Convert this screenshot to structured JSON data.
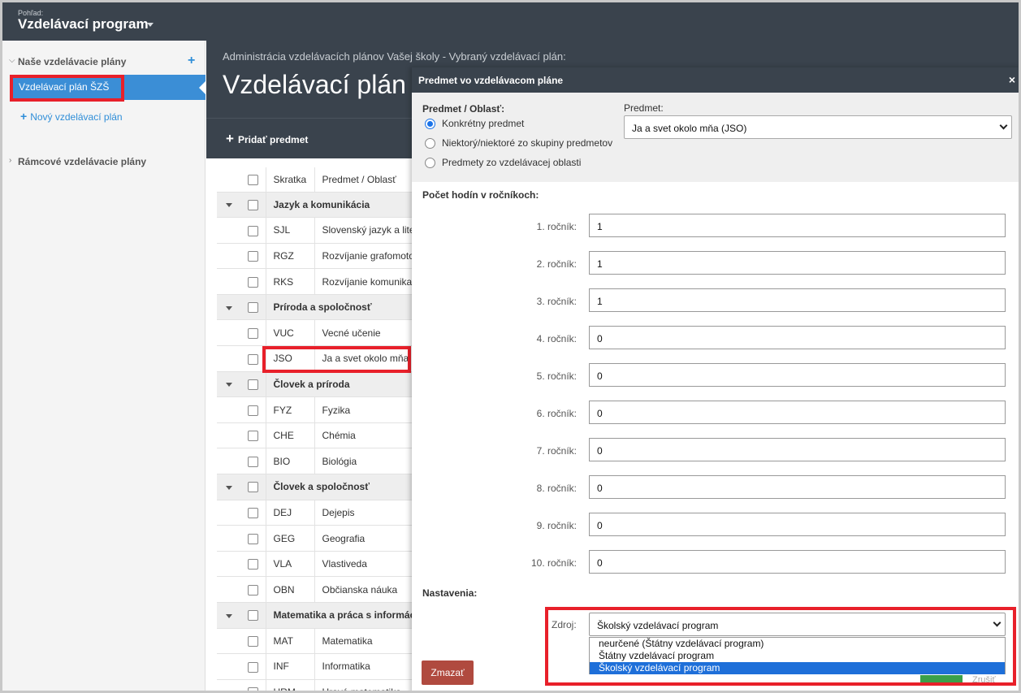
{
  "topbar": {
    "view_label": "Pohľad:",
    "title": "Vzdelávací program"
  },
  "sidebar": {
    "section_title": "Naše vzdelávacie plány",
    "active_item": "Vzdelávací plán ŠZŠ",
    "new_plan": "Nový vzdelávací plán",
    "framework_title": "Rámcové vzdelávacie plány"
  },
  "main": {
    "breadcrumb": "Administrácia vzdelávacích plánov Vašej školy - Vybraný vzdelávací plán:",
    "heading": "Vzdelávací plán",
    "add_subject": "Pridať predmet",
    "table": {
      "headers": [
        "Skratka",
        "Predmet / Oblasť"
      ],
      "rows": [
        {
          "type": "group",
          "name": "Jazyk a komunikácia"
        },
        {
          "type": "item",
          "abbr": "SJL",
          "name": "Slovenský jazyk a lite"
        },
        {
          "type": "item",
          "abbr": "RGZ",
          "name": "Rozvíjanie grafomoto"
        },
        {
          "type": "item",
          "abbr": "RKS",
          "name": "Rozvíjanie komunika"
        },
        {
          "type": "group",
          "name": "Príroda a spoločnosť"
        },
        {
          "type": "item",
          "abbr": "VUC",
          "name": "Vecné učenie"
        },
        {
          "type": "item",
          "abbr": "JSO",
          "name": "Ja a svet okolo mňa"
        },
        {
          "type": "group",
          "name": "Človek a príroda"
        },
        {
          "type": "item",
          "abbr": "FYZ",
          "name": "Fyzika"
        },
        {
          "type": "item",
          "abbr": "CHE",
          "name": "Chémia"
        },
        {
          "type": "item",
          "abbr": "BIO",
          "name": "Biológia"
        },
        {
          "type": "group",
          "name": "Človek a spoločnosť"
        },
        {
          "type": "item",
          "abbr": "DEJ",
          "name": "Dejepis"
        },
        {
          "type": "item",
          "abbr": "GEG",
          "name": "Geografia"
        },
        {
          "type": "item",
          "abbr": "VLA",
          "name": "Vlastiveda"
        },
        {
          "type": "item",
          "abbr": "OBN",
          "name": "Občianska náuka"
        },
        {
          "type": "group",
          "name": "Matematika a práca s informác"
        },
        {
          "type": "item",
          "abbr": "MAT",
          "name": "Matematika"
        },
        {
          "type": "item",
          "abbr": "INF",
          "name": "Informatika"
        },
        {
          "type": "item",
          "abbr": "HRM",
          "name": "Hravá matematika"
        }
      ]
    }
  },
  "modal": {
    "title": "Predmet vo vzdelávacom pláne",
    "close": "×",
    "subject_area_label": "Predmet / Oblasť:",
    "radio_options": [
      "Konkrétny predmet",
      "Niektorý/niektoré zo skupiny predmetov",
      "Predmety zo vzdelávacej oblasti"
    ],
    "radio_selected": 0,
    "subject_label": "Predmet:",
    "subject_value": "Ja a svet okolo mňa (JSO)",
    "hours_label": "Počet hodín v ročníkoch:",
    "grades": [
      {
        "label": "1. ročník:",
        "value": "1"
      },
      {
        "label": "2. ročník:",
        "value": "1"
      },
      {
        "label": "3. ročník:",
        "value": "1"
      },
      {
        "label": "4. ročník:",
        "value": "0"
      },
      {
        "label": "5. ročník:",
        "value": "0"
      },
      {
        "label": "6. ročník:",
        "value": "0"
      },
      {
        "label": "7. ročník:",
        "value": "0"
      },
      {
        "label": "8. ročník:",
        "value": "0"
      },
      {
        "label": "9. ročník:",
        "value": "0"
      },
      {
        "label": "10. ročník:",
        "value": "0"
      }
    ],
    "settings_label": "Nastavenia:",
    "source_label": "Zdroj:",
    "source_value": "Školský vzdelávací program",
    "source_options": [
      "neurčené (Štátny vzdelávací program)",
      "Štátny vzdelávací program",
      "Školský vzdelávací program"
    ],
    "source_selected": 2,
    "delete_button": "Zmazať",
    "cancel_button": "Zrušiť",
    "colors": {
      "header": "#3a434d",
      "accent": "#3b8ed6",
      "highlight": "#e8202a",
      "delete": "#b04a3f",
      "selected_option": "#1e6fd9"
    }
  }
}
